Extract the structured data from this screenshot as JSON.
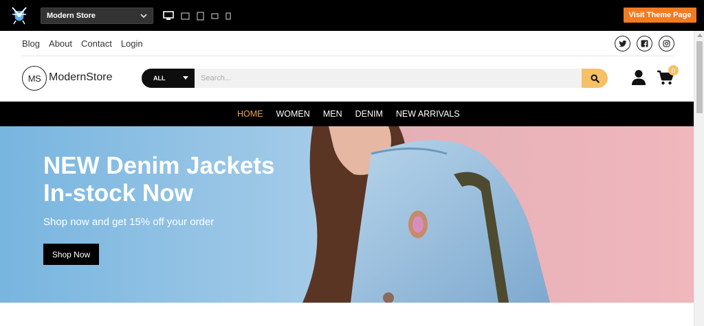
{
  "demo_bar": {
    "theme_name": "Modern Store",
    "visit_button": "Visit Theme Page",
    "devices": [
      "desktop-icon",
      "tablet-landscape-icon",
      "tablet-portrait-icon",
      "mobile-landscape-icon",
      "mobile-portrait-icon"
    ]
  },
  "top_links": [
    "Blog",
    "About",
    "Contact",
    "Login"
  ],
  "socials": [
    "twitter-icon",
    "facebook-icon",
    "instagram-icon"
  ],
  "brand": {
    "logo_text": "MS",
    "name": "ModernStore"
  },
  "search": {
    "category": "ALL",
    "placeholder": "Search..."
  },
  "cart": {
    "count": "0"
  },
  "nav": {
    "items": [
      "HOME",
      "WOMEN",
      "MEN",
      "DENIM",
      "NEW ARRIVALS"
    ],
    "active": "HOME"
  },
  "hero": {
    "title_line1": "NEW Denim Jackets",
    "title_line2": "In-stock Now",
    "subtitle": "Shop now and get 15% off your order",
    "button": "Shop Now"
  },
  "colors": {
    "accent": "#f27b22",
    "yellow": "#f6c066",
    "nav_active": "#f2a54a"
  }
}
